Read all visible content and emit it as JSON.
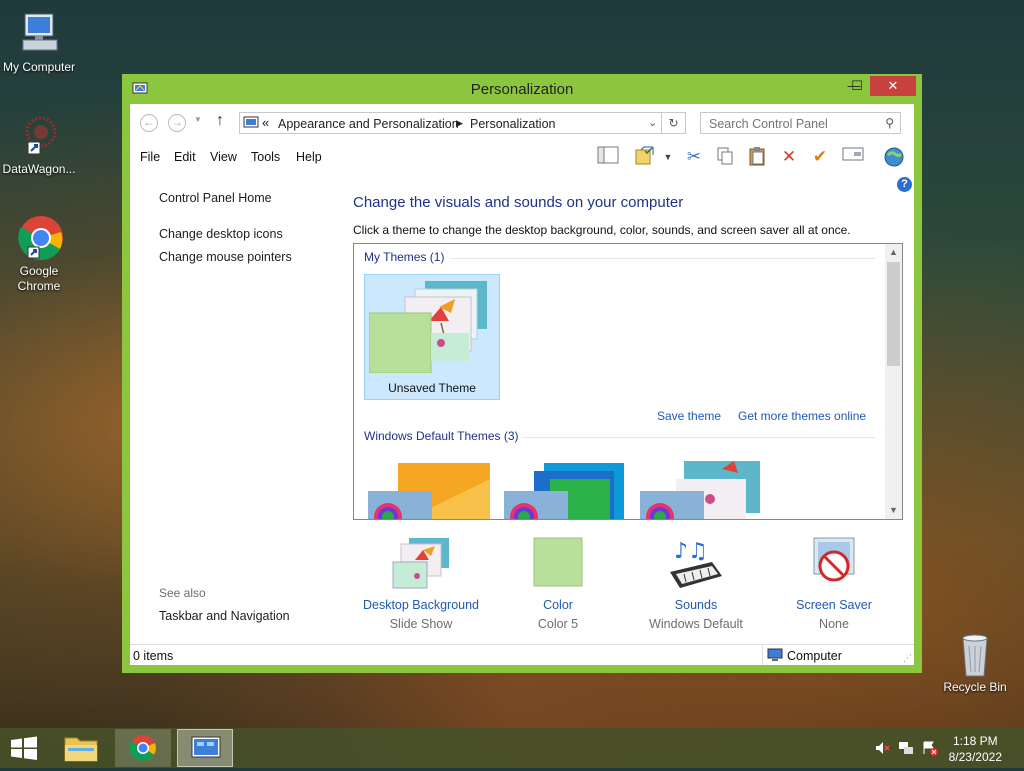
{
  "desktop": {
    "icons": [
      {
        "label": "My Computer"
      },
      {
        "label": "DataWagon..."
      },
      {
        "label": "Google Chrome"
      },
      {
        "label": "Recycle Bin"
      }
    ]
  },
  "window": {
    "title": "Personalization",
    "controls": {
      "minimize": "—",
      "maximize": "☐",
      "close": "✕"
    },
    "address": {
      "prefix": "«",
      "crumbs": [
        "Appearance and Personalization",
        "Personalization"
      ]
    },
    "search": {
      "placeholder": "Search Control Panel"
    },
    "menu": [
      "File",
      "Edit",
      "View",
      "Tools",
      "Help"
    ],
    "sidebar": {
      "home": "Control Panel Home",
      "links": [
        "Change desktop icons",
        "Change mouse pointers"
      ],
      "see_also_label": "See also",
      "see_also_links": [
        "Taskbar and Navigation"
      ]
    },
    "main": {
      "heading": "Change the visuals and sounds on your computer",
      "description": "Click a theme to change the desktop background, color, sounds, and screen saver all at once.",
      "my_themes_header": "My Themes (1)",
      "unsaved_theme": "Unsaved Theme",
      "save_theme": "Save theme",
      "get_more": "Get more themes online",
      "default_themes_header": "Windows Default Themes (3)"
    },
    "settings": [
      {
        "label": "Desktop Background",
        "value": "Slide Show"
      },
      {
        "label": "Color",
        "value": "Color 5"
      },
      {
        "label": "Sounds",
        "value": "Windows Default"
      },
      {
        "label": "Screen Saver",
        "value": "None"
      }
    ],
    "status": {
      "items": "0 items",
      "location": "Computer"
    }
  },
  "taskbar": {
    "clock": {
      "time": "1:18 PM",
      "date": "8/23/2022"
    }
  },
  "colors": {
    "accent": "#8cc63f",
    "link": "#1e5ab4",
    "heading": "#1e3287",
    "selection": "#cce8ff"
  }
}
